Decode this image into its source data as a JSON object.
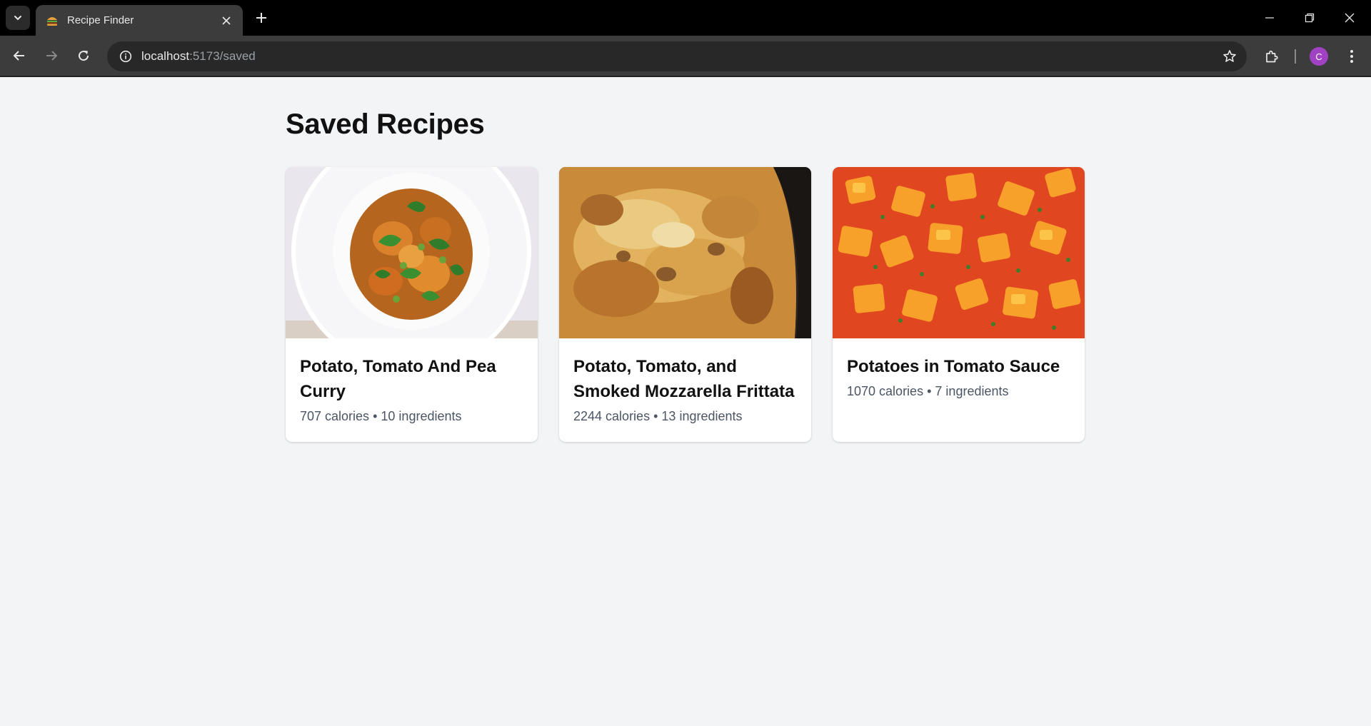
{
  "browser": {
    "tab_title": "Recipe Finder",
    "url_host": "localhost",
    "url_path": ":5173/saved",
    "avatar_letter": "C",
    "favicon": "burger-icon"
  },
  "page": {
    "title": "Saved Recipes"
  },
  "recipes": [
    {
      "title": "Potato, Tomato And Pea Curry",
      "calories": "707 calories",
      "separator": "•",
      "ingredients": "10 ingredients",
      "image": "curry-bowl-image"
    },
    {
      "title": "Potato, Tomato, and Smoked Mozzarella Frittata",
      "calories": "2244 calories",
      "separator": "•",
      "ingredients": "13 ingredients",
      "image": "frittata-pan-image"
    },
    {
      "title": "Potatoes in Tomato Sauce",
      "calories": "1070 calories",
      "separator": "•",
      "ingredients": "7 ingredients",
      "image": "tomato-sauce-potatoes-image"
    }
  ]
}
